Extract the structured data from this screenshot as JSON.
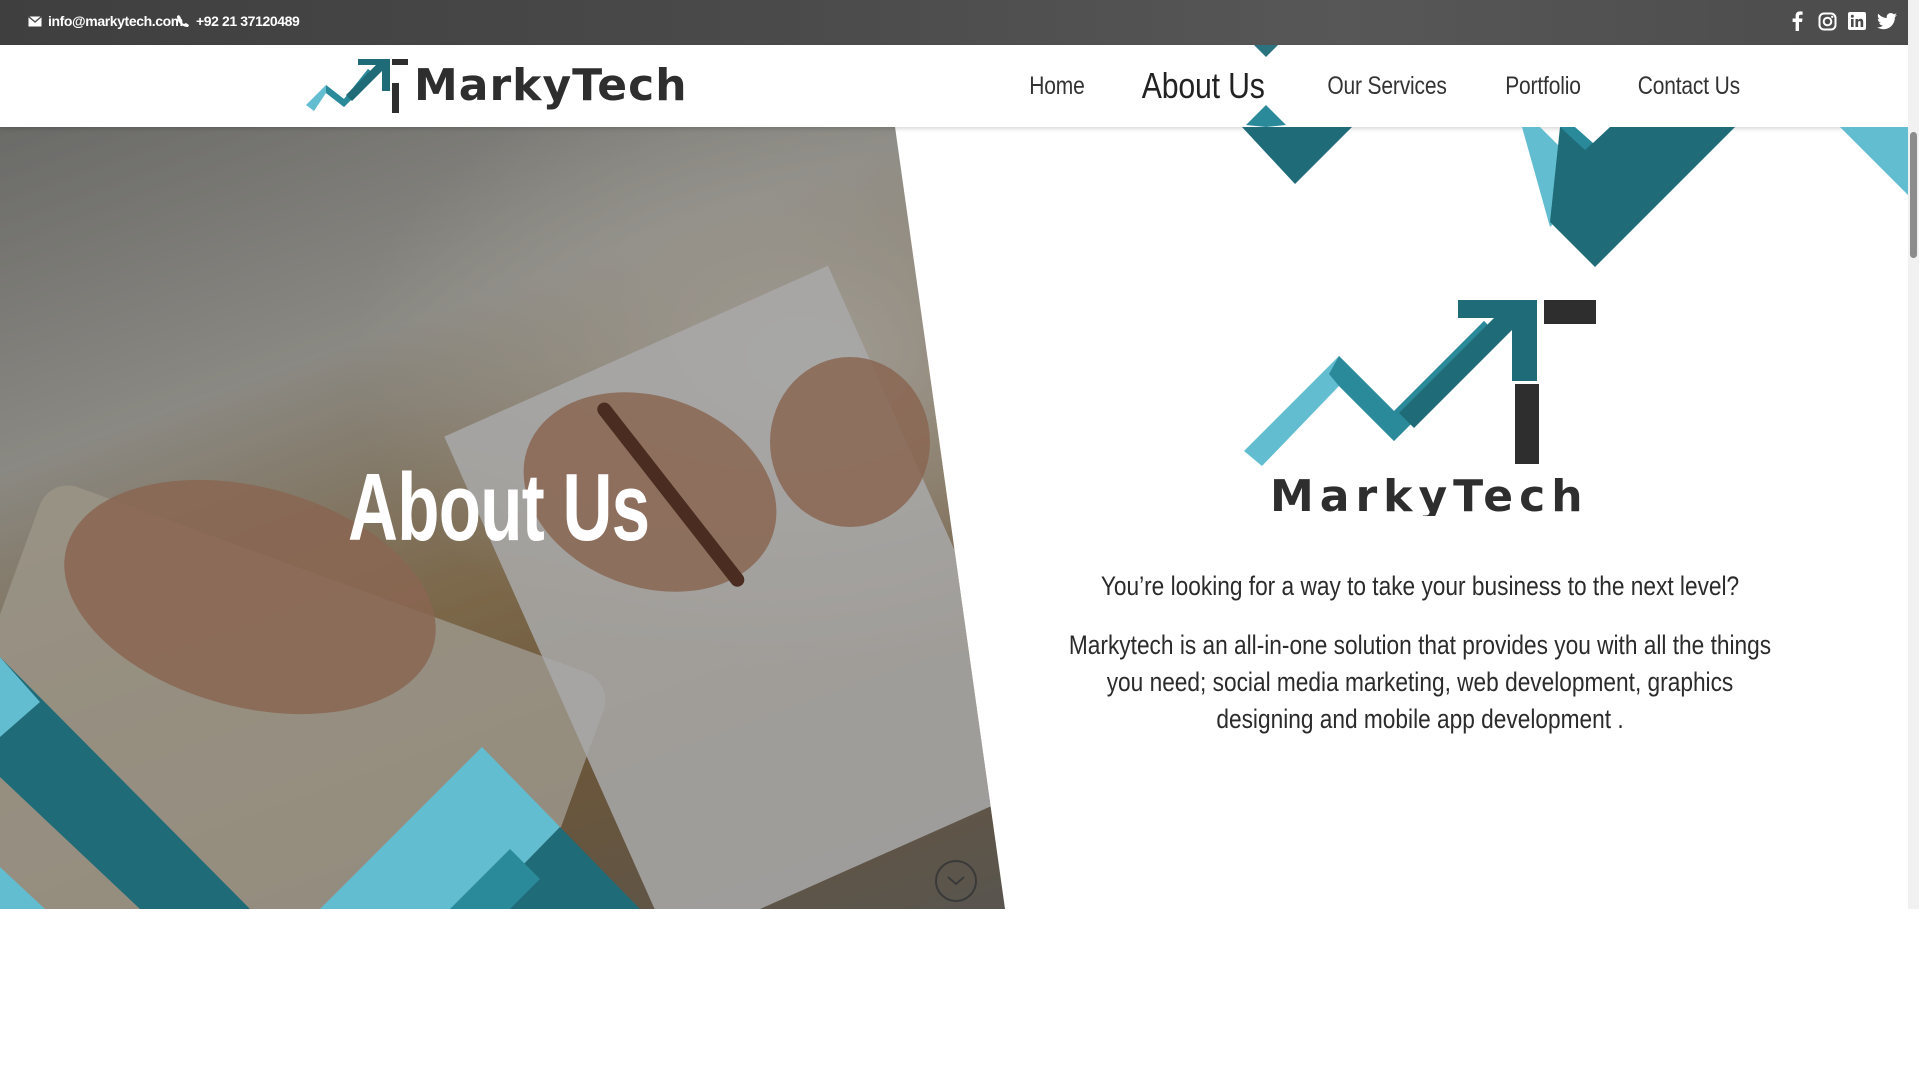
{
  "topbar": {
    "email": "info@markytech.com",
    "phone": "+92 21 37120489",
    "socials": [
      "facebook-icon",
      "instagram-icon",
      "linkedin-icon",
      "twitter-icon"
    ]
  },
  "brand": {
    "name": "MarkyTech",
    "colors": {
      "dark_teal": "#1f6b78",
      "mid_teal": "#2a8a9a",
      "light_teal": "#62bdd0",
      "charcoal": "#2e2e2e"
    }
  },
  "nav": {
    "items": [
      {
        "label": "Home"
      },
      {
        "label": "About Us",
        "active": true
      },
      {
        "label": "Our Services"
      },
      {
        "label": "Portfolio"
      },
      {
        "label": "Contact Us"
      }
    ]
  },
  "hero": {
    "title": "About Us"
  },
  "about": {
    "tagline": "You’re looking for a way to take your business to the next level?",
    "description": "Markytech is an all-in-one solution that provides you with all the things you need; social media marketing, web development, graphics designing and mobile app development ."
  }
}
